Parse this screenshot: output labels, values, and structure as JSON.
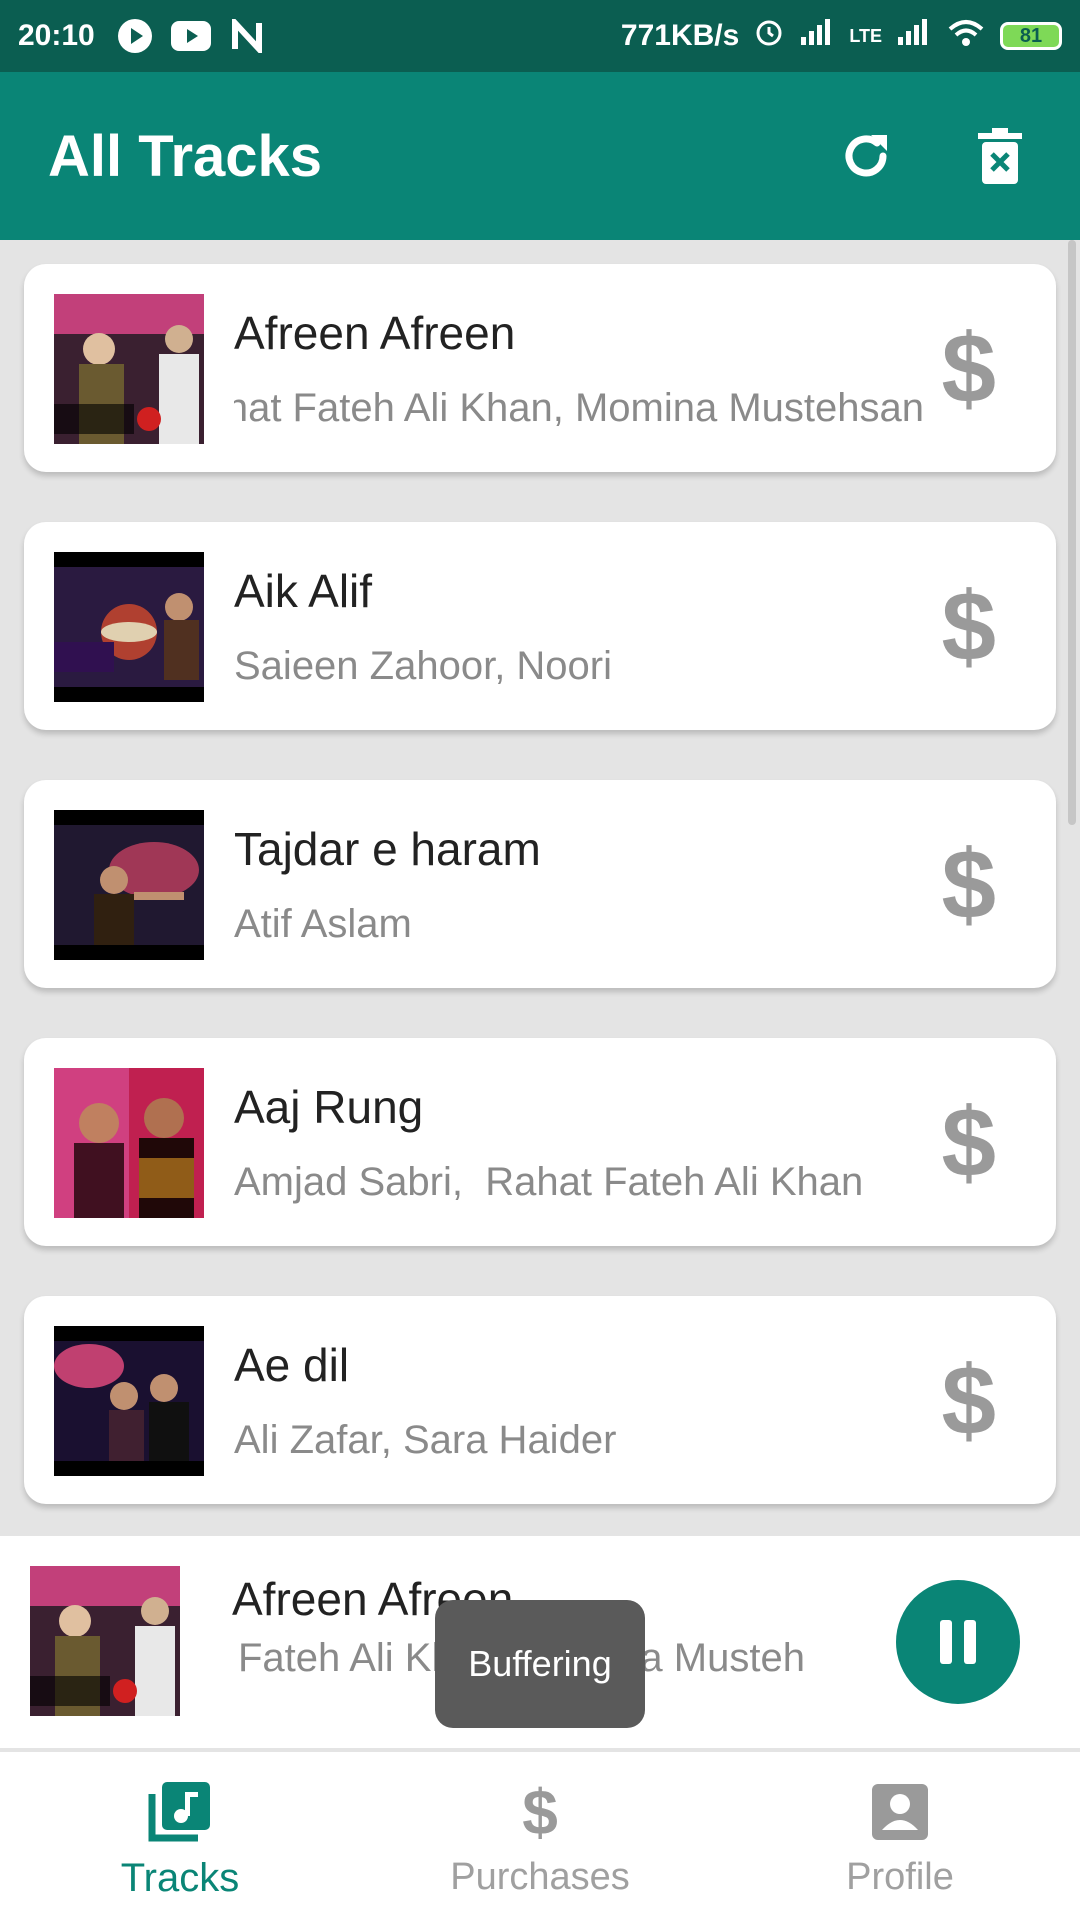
{
  "status_bar": {
    "time": "20:10",
    "speed": "771KB/s",
    "battery": "81",
    "network": "LTE"
  },
  "header": {
    "title": "All Tracks",
    "refresh_icon": "refresh-icon",
    "delete_icon": "delete-icon"
  },
  "tracks": [
    {
      "title": "Afreen Afreen",
      "artist": "Rahat Fateh Ali Khan, Momina Mustehsan",
      "buy_label": "$"
    },
    {
      "title": "Aik Alif",
      "artist": "Saieen Zahoor, Noori",
      "buy_label": "$"
    },
    {
      "title": "Tajdar e haram",
      "artist": "Atif Aslam",
      "buy_label": "$"
    },
    {
      "title": "Aaj Rung",
      "artist": "Amjad Sabri,  Rahat Fateh Ali Khan",
      "buy_label": "$"
    },
    {
      "title": "Ae dil",
      "artist": "Ali Zafar, Sara Haider",
      "buy_label": "$"
    }
  ],
  "now_playing": {
    "title": "Afreen Afreen",
    "artist": "Fateh Ali Khan, Momina Musteh"
  },
  "toast": {
    "text": "Buffering"
  },
  "bottom_nav": [
    {
      "label": "Tracks",
      "icon": "music-library-icon",
      "active": true
    },
    {
      "label": "Purchases",
      "icon": "dollar-icon",
      "active": false
    },
    {
      "label": "Profile",
      "icon": "profile-icon",
      "active": false
    }
  ],
  "colors": {
    "primary": "#0a8576",
    "status_bar": "#0b5e51",
    "background": "#e4e4e4"
  }
}
